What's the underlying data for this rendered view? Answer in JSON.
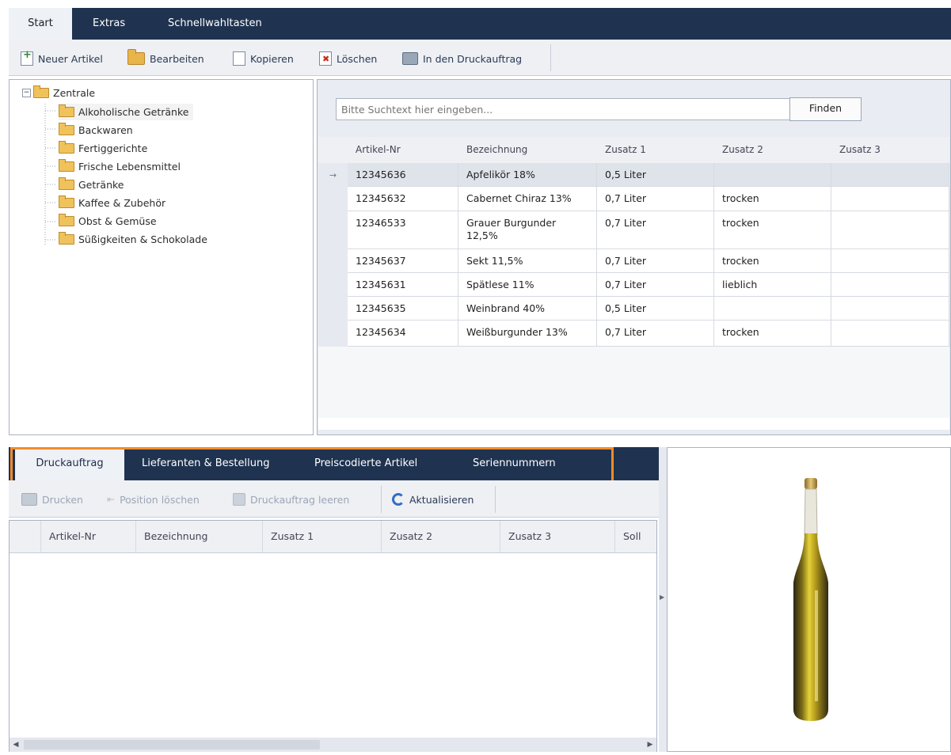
{
  "ribbon": {
    "tabs": [
      "Start",
      "Extras",
      "Schnellwahltasten"
    ]
  },
  "toolbar": {
    "new_label": "Neuer Artikel",
    "edit_label": "Bearbeiten",
    "copy_label": "Kopieren",
    "delete_label": "Löschen",
    "print_job_label": "In den Druckauftrag"
  },
  "tree": {
    "root": "Zentrale",
    "items": [
      "Alkoholische Getränke",
      "Backwaren",
      "Fertiggerichte",
      "Frische Lebensmittel",
      "Getränke",
      "Kaffee & Zubehör",
      "Obst & Gemüse",
      "Süßigkeiten & Schokolade"
    ],
    "selected": "Alkoholische Getränke"
  },
  "search": {
    "placeholder": "Bitte Suchtext hier eingeben...",
    "button": "Finden"
  },
  "grid": {
    "columns": [
      "Artikel-Nr",
      "Bezeichnung",
      "Zusatz 1",
      "Zusatz 2",
      "Zusatz 3"
    ],
    "current_row_marker": "→",
    "rows": [
      [
        "12345636",
        "Apfelikör 18%",
        "0,5 Liter",
        "",
        ""
      ],
      [
        "12345632",
        "Cabernet Chiraz 13%",
        "0,7 Liter",
        "trocken",
        ""
      ],
      [
        "12346533",
        "Grauer Burgunder 12,5%",
        "0,7 Liter",
        "trocken",
        ""
      ],
      [
        "12345637",
        "Sekt 11,5%",
        "0,7 Liter",
        "trocken",
        ""
      ],
      [
        "12345631",
        "Spätlese 11%",
        "0,7 Liter",
        "lieblich",
        ""
      ],
      [
        "12345635",
        "Weinbrand 40%",
        "0,5 Liter",
        "",
        ""
      ],
      [
        "12345634",
        "Weißburgunder 13%",
        "0,7 Liter",
        "trocken",
        ""
      ]
    ]
  },
  "bottom_tabs": {
    "tabs": [
      "Druckauftrag",
      "Lieferanten & Bestellung",
      "Preiscodierte Artikel",
      "Seriennummern"
    ],
    "active": "Druckauftrag",
    "highlight_color": "#f28c2a"
  },
  "bottom_toolbar": {
    "print": "Drucken",
    "delete_position": "Position löschen",
    "clear_job": "Druckauftrag leeren",
    "refresh": "Aktualisieren"
  },
  "bottom_grid": {
    "columns": [
      "Artikel-Nr",
      "Bezeichnung",
      "Zusatz 1",
      "Zusatz 2",
      "Zusatz 3",
      "Soll"
    ]
  },
  "colors": {
    "header_bar": "#1f3350",
    "accent_highlight": "#f28c2a",
    "folder": "#f0c25b"
  }
}
